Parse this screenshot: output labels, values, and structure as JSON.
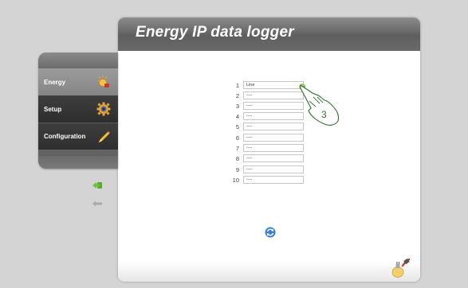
{
  "header": {
    "title": "Energy IP data logger"
  },
  "sidebar": {
    "items": [
      {
        "label": "Energy",
        "icon": "energy-bulb-icon"
      },
      {
        "label": "Setup",
        "icon": "gear-icon"
      },
      {
        "label": "Configuration",
        "icon": "pencil-icon"
      }
    ]
  },
  "lines": [
    {
      "num": "1",
      "value": "Line"
    },
    {
      "num": "2",
      "value": "----"
    },
    {
      "num": "3",
      "value": "----"
    },
    {
      "num": "4",
      "value": "----"
    },
    {
      "num": "5",
      "value": "----"
    },
    {
      "num": "6",
      "value": "----"
    },
    {
      "num": "7",
      "value": "----"
    },
    {
      "num": "8",
      "value": "----"
    },
    {
      "num": "9",
      "value": "----"
    },
    {
      "num": "10",
      "value": "----"
    }
  ],
  "callout": {
    "step": "3"
  },
  "colors": {
    "accent_green": "#5fa52b",
    "header_gray": "#6a6a6a"
  }
}
